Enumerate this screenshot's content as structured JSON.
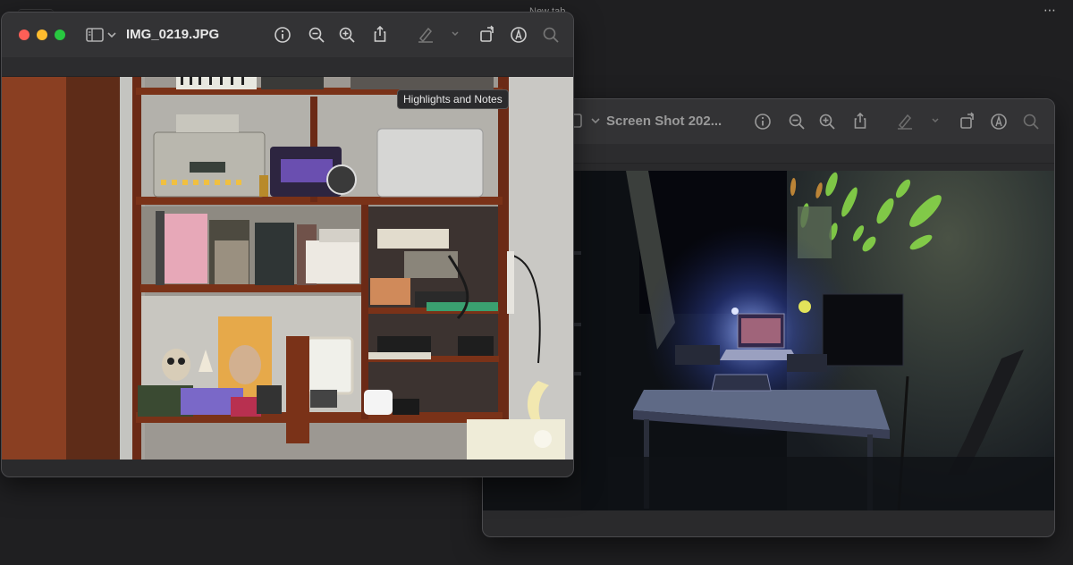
{
  "browser": {
    "tab_title": "New tab",
    "more_menu": "⋯"
  },
  "front_window": {
    "title": "IMG_0219.JPG",
    "sidebar_toggle_icon": "sidebar-icon",
    "toolbar_icons": [
      "info-icon",
      "zoom-out-icon",
      "zoom-in-icon",
      "share-icon",
      "highlight-pen-icon",
      "chevron-down-icon",
      "rotate-icon",
      "markup-icon",
      "search-icon"
    ],
    "tooltip": "Highlights and Notes"
  },
  "back_window": {
    "title": "Screen Shot 202...",
    "toolbar_icons": [
      "info-icon",
      "zoom-out-icon",
      "zoom-in-icon",
      "share-icon",
      "highlight-pen-icon",
      "chevron-down-icon",
      "rotate-icon",
      "markup-icon",
      "search-icon"
    ]
  },
  "colors": {
    "close": "#ff5f57",
    "minimize": "#febc2e",
    "zoom": "#28c840",
    "window_bg": "#2a2a2c",
    "toolbar_bg": "#333335"
  }
}
